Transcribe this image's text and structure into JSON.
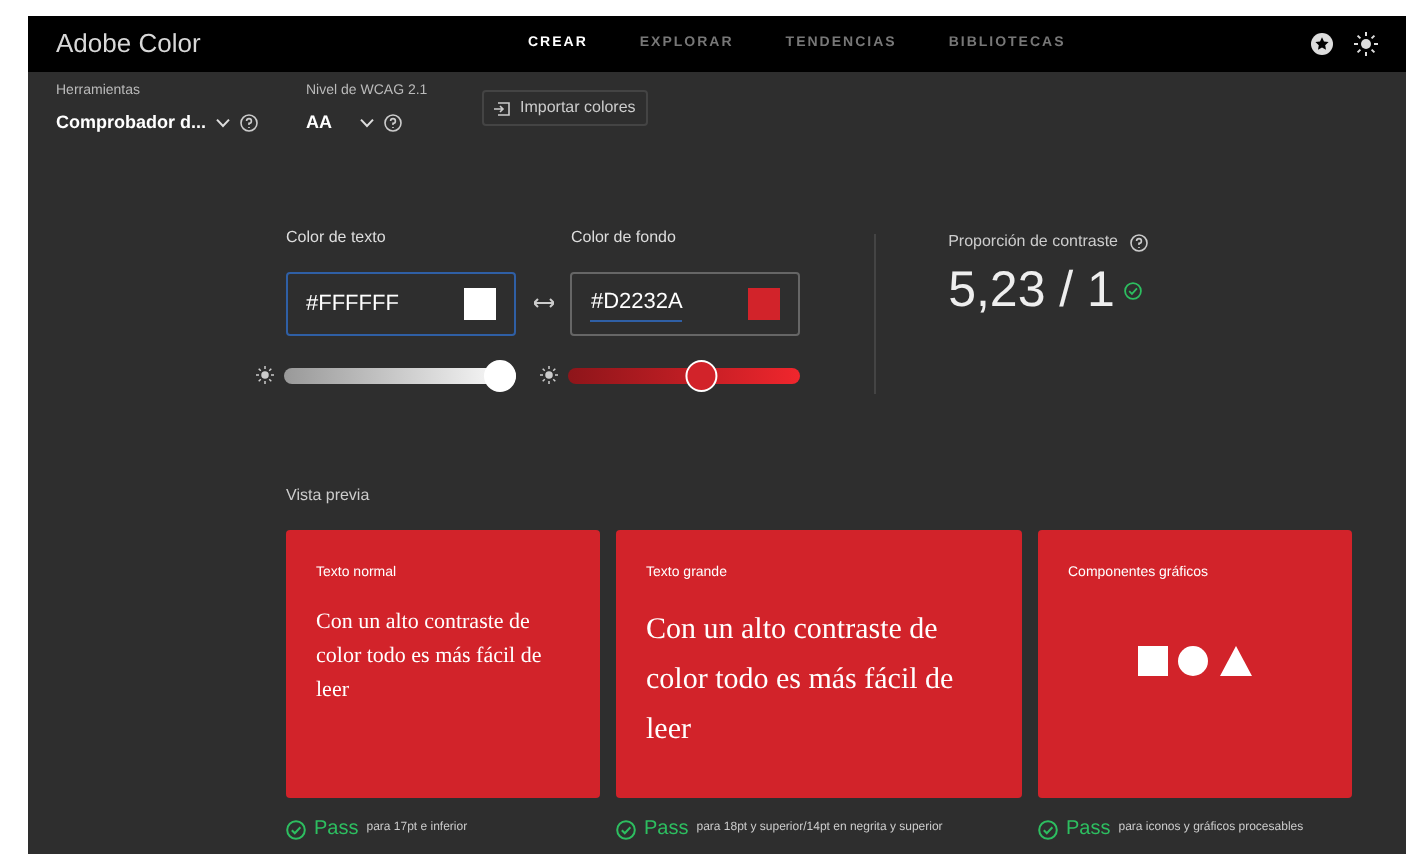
{
  "app": {
    "title": "Adobe Color"
  },
  "nav": [
    {
      "label": "CREAR",
      "selected": true
    },
    {
      "label": "EXPLORAR",
      "selected": false
    },
    {
      "label": "TENDENCIAS",
      "selected": false
    },
    {
      "label": "BIBLIOTECAS",
      "selected": false
    }
  ],
  "toolbar": {
    "tools": {
      "label": "Herramientas",
      "value": "Comprobador d..."
    },
    "wcag": {
      "label": "Nivel de WCAG 2.1",
      "value": "AA"
    },
    "import_button": "Importar colores"
  },
  "text_color": {
    "label": "Color de texto",
    "value": "#FFFFFF",
    "color": "#ffffff",
    "level": 1.0,
    "focused": true
  },
  "background_color": {
    "label": "Color de fondo",
    "value": "#D2232A",
    "color": "#d2232a",
    "level": 0.58,
    "focused": false
  },
  "contrast": {
    "label": "Proporción de contraste",
    "ratio": "5,23 / 1",
    "passed": true
  },
  "preview": {
    "label": "Vista previa",
    "cards": [
      {
        "kind": "text_normal",
        "title": "Texto normal",
        "sample": "Con un alto contraste de color todo es más fácil de leer",
        "result": "Pass",
        "note": "para 17pt e inferior",
        "passed": true
      },
      {
        "kind": "text_large",
        "title": "Texto grande",
        "sample": "Con un alto contraste de color todo es más fácil de leer",
        "result": "Pass",
        "note": "para 18pt y superior/14pt en negrita y superior",
        "passed": true
      },
      {
        "kind": "shapes",
        "title": "Componentes gráficos",
        "result": "Pass",
        "note": "para iconos y gráficos procesables",
        "passed": true
      }
    ]
  }
}
